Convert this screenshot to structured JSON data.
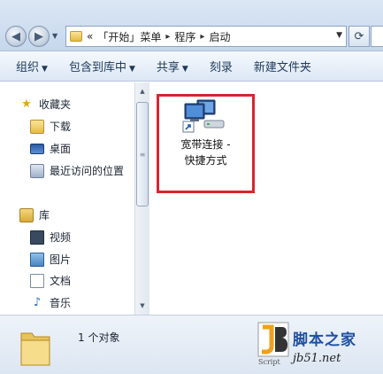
{
  "address_bar": {
    "overflow_marker": "«",
    "crumbs": [
      "「开始」菜单",
      "程序",
      "启动"
    ],
    "separator": "▸"
  },
  "toolbar": {
    "organize": "组织",
    "include_in_library": "包含到库中",
    "share": "共享",
    "burn": "刻录",
    "new_folder": "新建文件夹"
  },
  "nav": {
    "favorites": "收藏夹",
    "downloads": "下载",
    "desktop": "桌面",
    "recent": "最近访问的位置",
    "libraries": "库",
    "videos": "视频",
    "pictures": "图片",
    "documents": "文档",
    "music": "音乐"
  },
  "file": {
    "name_line1": "宽带连接 -",
    "name_line2": "快捷方式"
  },
  "details": {
    "count": "1 个对象"
  },
  "watermark": {
    "logo_script": "Script",
    "name": "脚本之家",
    "url": "jb51.net"
  },
  "colors": {
    "highlight_border": "#d6262e",
    "watermark_blue": "#1f4fa3"
  }
}
